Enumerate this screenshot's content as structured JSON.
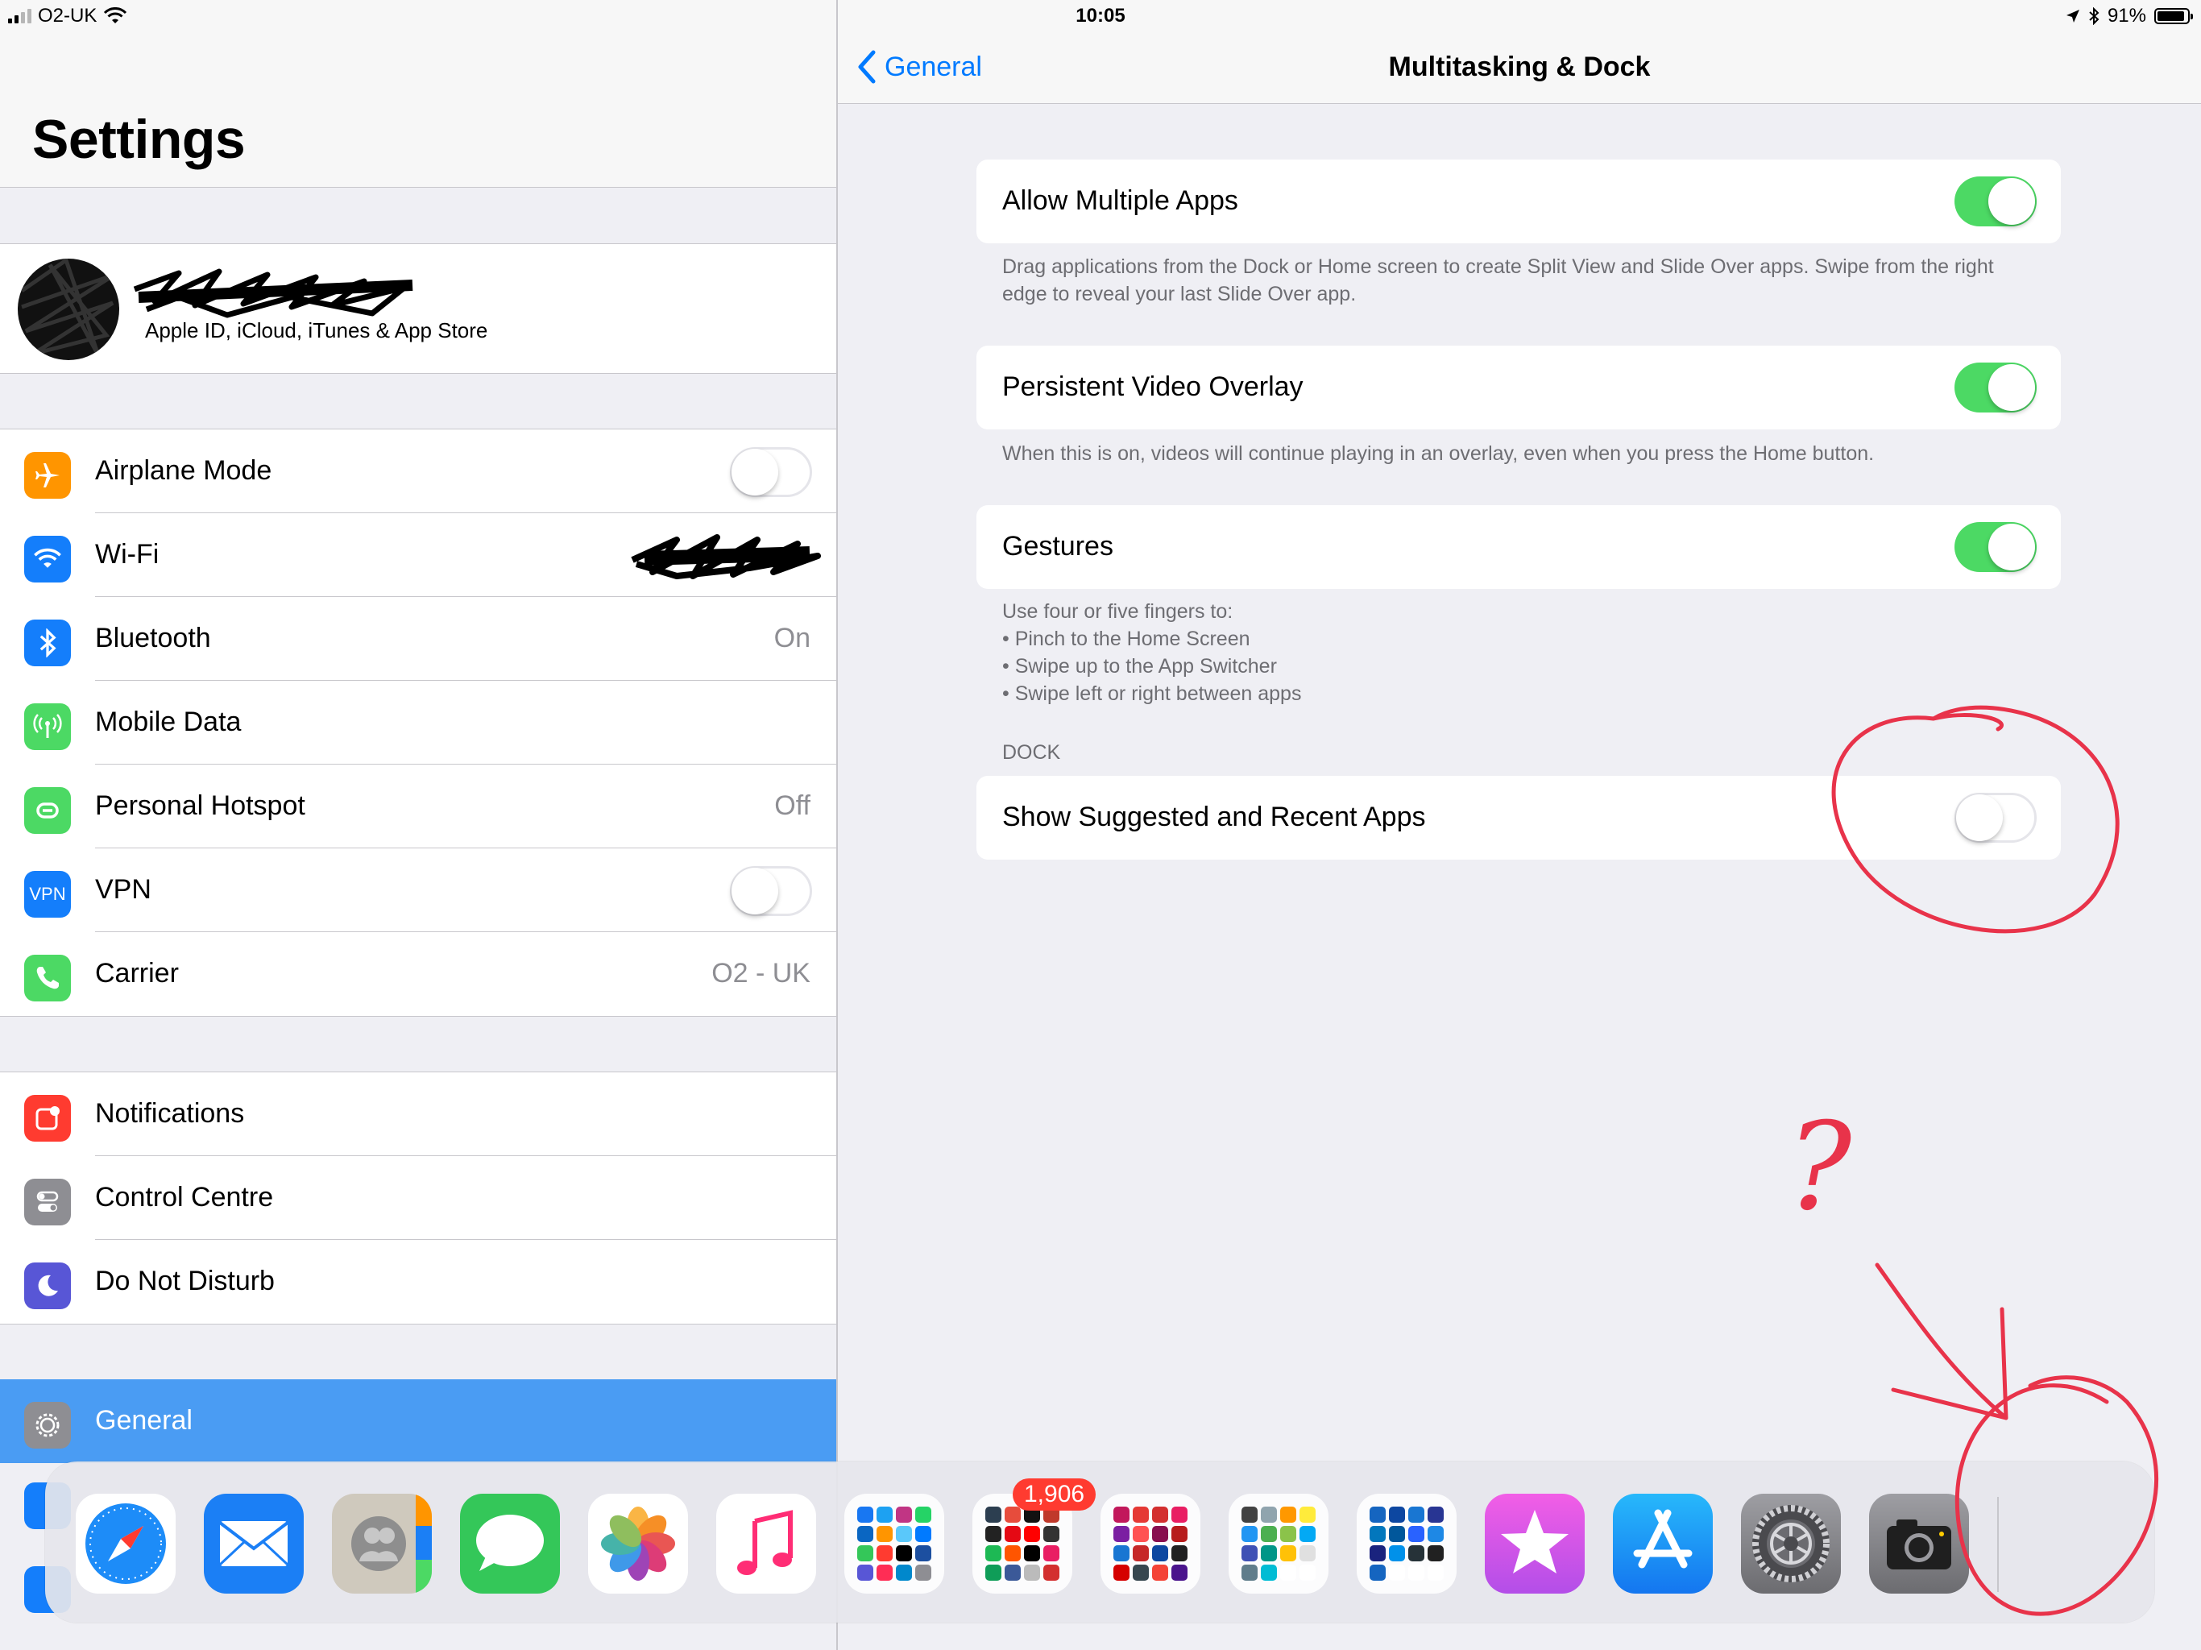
{
  "status_bar": {
    "carrier": "O2-UK",
    "time": "10:05",
    "battery_percent": "91%",
    "battery_level": 0.91
  },
  "sidebar": {
    "title": "Settings",
    "profile_subtitle": "Apple ID, iCloud, iTunes & App Store",
    "connectivity": [
      {
        "label": "Airplane Mode",
        "icon": "airplane-icon",
        "color": "#ff9500",
        "control": "switch",
        "on": false
      },
      {
        "label": "Wi-Fi",
        "icon": "wifi-icon",
        "color": "#147efb",
        "control": "redacted"
      },
      {
        "label": "Bluetooth",
        "icon": "bluetooth-icon",
        "color": "#147efb",
        "value": "On"
      },
      {
        "label": "Mobile Data",
        "icon": "antenna-icon",
        "color": "#4cd964"
      },
      {
        "label": "Personal Hotspot",
        "icon": "hotspot-icon",
        "color": "#4cd964",
        "value": "Off"
      },
      {
        "label": "VPN",
        "icon": "vpn-icon",
        "icon_text": "VPN",
        "color": "#147efb",
        "control": "switch",
        "on": false
      },
      {
        "label": "Carrier",
        "icon": "phone-icon",
        "color": "#4cd964",
        "value": "O2 - UK"
      }
    ],
    "system": [
      {
        "label": "Notifications",
        "icon": "notifications-icon",
        "color": "#ff3b30"
      },
      {
        "label": "Control Centre",
        "icon": "control-centre-icon",
        "color": "#8e8e93"
      },
      {
        "label": "Do Not Disturb",
        "icon": "moon-icon",
        "color": "#5856d6"
      }
    ],
    "selected": {
      "label": "General",
      "icon": "gear-icon",
      "color": "#8e8e93"
    }
  },
  "detail": {
    "back_label": "General",
    "title": "Multitasking & Dock",
    "settings": [
      {
        "label": "Allow Multiple Apps",
        "on": true,
        "footer": "Drag applications from the Dock or Home screen to create Split View and Slide Over apps. Swipe from the right edge to reveal your last Slide Over app."
      },
      {
        "label": "Persistent Video Overlay",
        "on": true,
        "footer": "When this is on, videos will continue playing in an overlay, even when you press the Home button."
      },
      {
        "label": "Gestures",
        "on": true
      }
    ],
    "gestures_footer": {
      "intro": "Use four or five fingers to:",
      "bullets": [
        "• Pinch to the Home Screen",
        "• Swipe up to the App Switcher",
        "• Swipe left or right between apps"
      ]
    },
    "dock_section_header": "DOCK",
    "dock_setting": {
      "label": "Show Suggested and Recent Apps",
      "on": false
    }
  },
  "dock": {
    "apps": [
      {
        "name": "Safari",
        "icon": "safari-icon"
      },
      {
        "name": "Mail",
        "icon": "mail-icon"
      },
      {
        "name": "Contacts",
        "icon": "contacts-icon"
      },
      {
        "name": "Messages",
        "icon": "messages-icon"
      },
      {
        "name": "Photos",
        "icon": "photos-icon"
      },
      {
        "name": "Music",
        "icon": "music-icon"
      },
      {
        "name": "Folder 1",
        "icon": "folder-icon"
      },
      {
        "name": "Folder 2",
        "icon": "folder-icon",
        "badge": "1,906"
      },
      {
        "name": "Folder 3",
        "icon": "folder-icon"
      },
      {
        "name": "Folder 4",
        "icon": "folder-icon"
      },
      {
        "name": "Folder 5",
        "icon": "folder-icon"
      },
      {
        "name": "iTunes Store",
        "icon": "star-icon"
      },
      {
        "name": "App Store",
        "icon": "app-store-icon"
      },
      {
        "name": "Settings",
        "icon": "settings-gear-icon"
      },
      {
        "name": "Camera",
        "icon": "camera-icon"
      }
    ]
  },
  "annotations": {
    "question_mark": "?"
  }
}
